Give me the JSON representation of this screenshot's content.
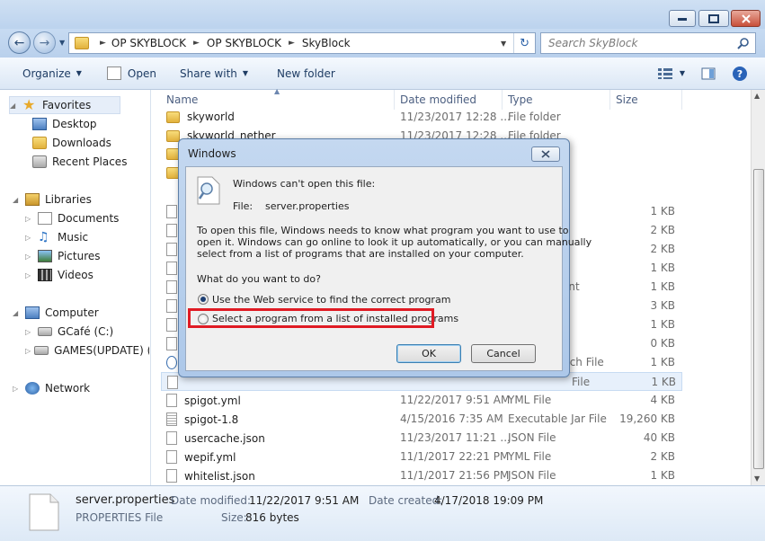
{
  "address": {
    "crumbs": [
      "OP SKYBLOCK",
      "OP SKYBLOCK",
      "SkyBlock"
    ],
    "search_placeholder": "Search SkyBlock"
  },
  "toolbar": {
    "organize": "Organize",
    "open": "Open",
    "share_with": "Share with",
    "new_folder": "New folder"
  },
  "nav": {
    "favorites": "Favorites",
    "desktop": "Desktop",
    "downloads": "Downloads",
    "recent_places": "Recent Places",
    "libraries": "Libraries",
    "documents": "Documents",
    "music": "Music",
    "pictures": "Pictures",
    "videos": "Videos",
    "computer": "Computer",
    "drive_c": "GCafé (C:)",
    "drive_e": "GAMES(UPDATE) (E:",
    "network": "Network"
  },
  "columns": {
    "name": "Name",
    "date": "Date modified",
    "type": "Type",
    "size": "Size"
  },
  "files": [
    {
      "name": "skyworld",
      "date": "11/23/2017 12:28 ...",
      "type": "File folder",
      "size": ""
    },
    {
      "name": "skyworld_nether",
      "date": "11/23/2017 12:28 ...",
      "type": "File folder",
      "size": ""
    },
    {
      "name": "",
      "date": "",
      "type": "",
      "size": ""
    },
    {
      "name": "",
      "date": "",
      "type": "",
      "size": ""
    },
    {
      "name": "",
      "date": "",
      "type": "",
      "size": "1 KB"
    },
    {
      "name": "",
      "date": "",
      "type": "",
      "size": "2 KB"
    },
    {
      "name": "",
      "date": "",
      "type": "",
      "size": "2 KB"
    },
    {
      "name": "",
      "date": "",
      "type": "",
      "size": "1 KB"
    },
    {
      "name": "",
      "date": "",
      "type": "ent",
      "size": "1 KB"
    },
    {
      "name": "",
      "date": "",
      "type": "",
      "size": "3 KB"
    },
    {
      "name": "",
      "date": "",
      "type": "",
      "size": "1 KB"
    },
    {
      "name": "",
      "date": "",
      "type": "",
      "size": "0 KB"
    },
    {
      "name": "",
      "date": "",
      "type": "tch File",
      "size": "1 KB"
    },
    {
      "name": "",
      "date": "",
      "type": "File",
      "size": "1 KB"
    },
    {
      "name": "spigot.yml",
      "date": "11/22/2017 9:51 AM",
      "type": "YML File",
      "size": "4 KB"
    },
    {
      "name": "spigot-1.8",
      "date": "4/15/2016 7:35 AM",
      "type": "Executable Jar File",
      "size": "19,260 KB"
    },
    {
      "name": "usercache.json",
      "date": "11/23/2017 11:21 ...",
      "type": "JSON File",
      "size": "40 KB"
    },
    {
      "name": "wepif.yml",
      "date": "11/1/2017 22:21 PM",
      "type": "YML File",
      "size": "2 KB"
    },
    {
      "name": "whitelist.json",
      "date": "11/1/2017 21:56 PM",
      "type": "JSON File",
      "size": "1 KB"
    }
  ],
  "details": {
    "filename": "server.properties",
    "filetype": "PROPERTIES File",
    "modified_label": "Date modified:",
    "modified_value": "11/22/2017 9:51 AM",
    "created_label": "Date created:",
    "created_value": "4/17/2018 19:09 PM",
    "size_label": "Size:",
    "size_value": "816 bytes"
  },
  "dialog": {
    "title": "Windows",
    "heading": "Windows can't open this file:",
    "file_label": "File:",
    "file_value": "server.properties",
    "explain_1": "To open this file, Windows needs to know what program you want to use to",
    "explain_2": "open it. Windows can go online to look it up automatically, or you can manually",
    "explain_3": "select from a list of programs that are installed on your computer.",
    "question": "What do you want to do?",
    "option_web": "Use the Web service to find the correct program",
    "option_list": "Select a program from a list of installed programs",
    "ok": "OK",
    "cancel": "Cancel"
  }
}
